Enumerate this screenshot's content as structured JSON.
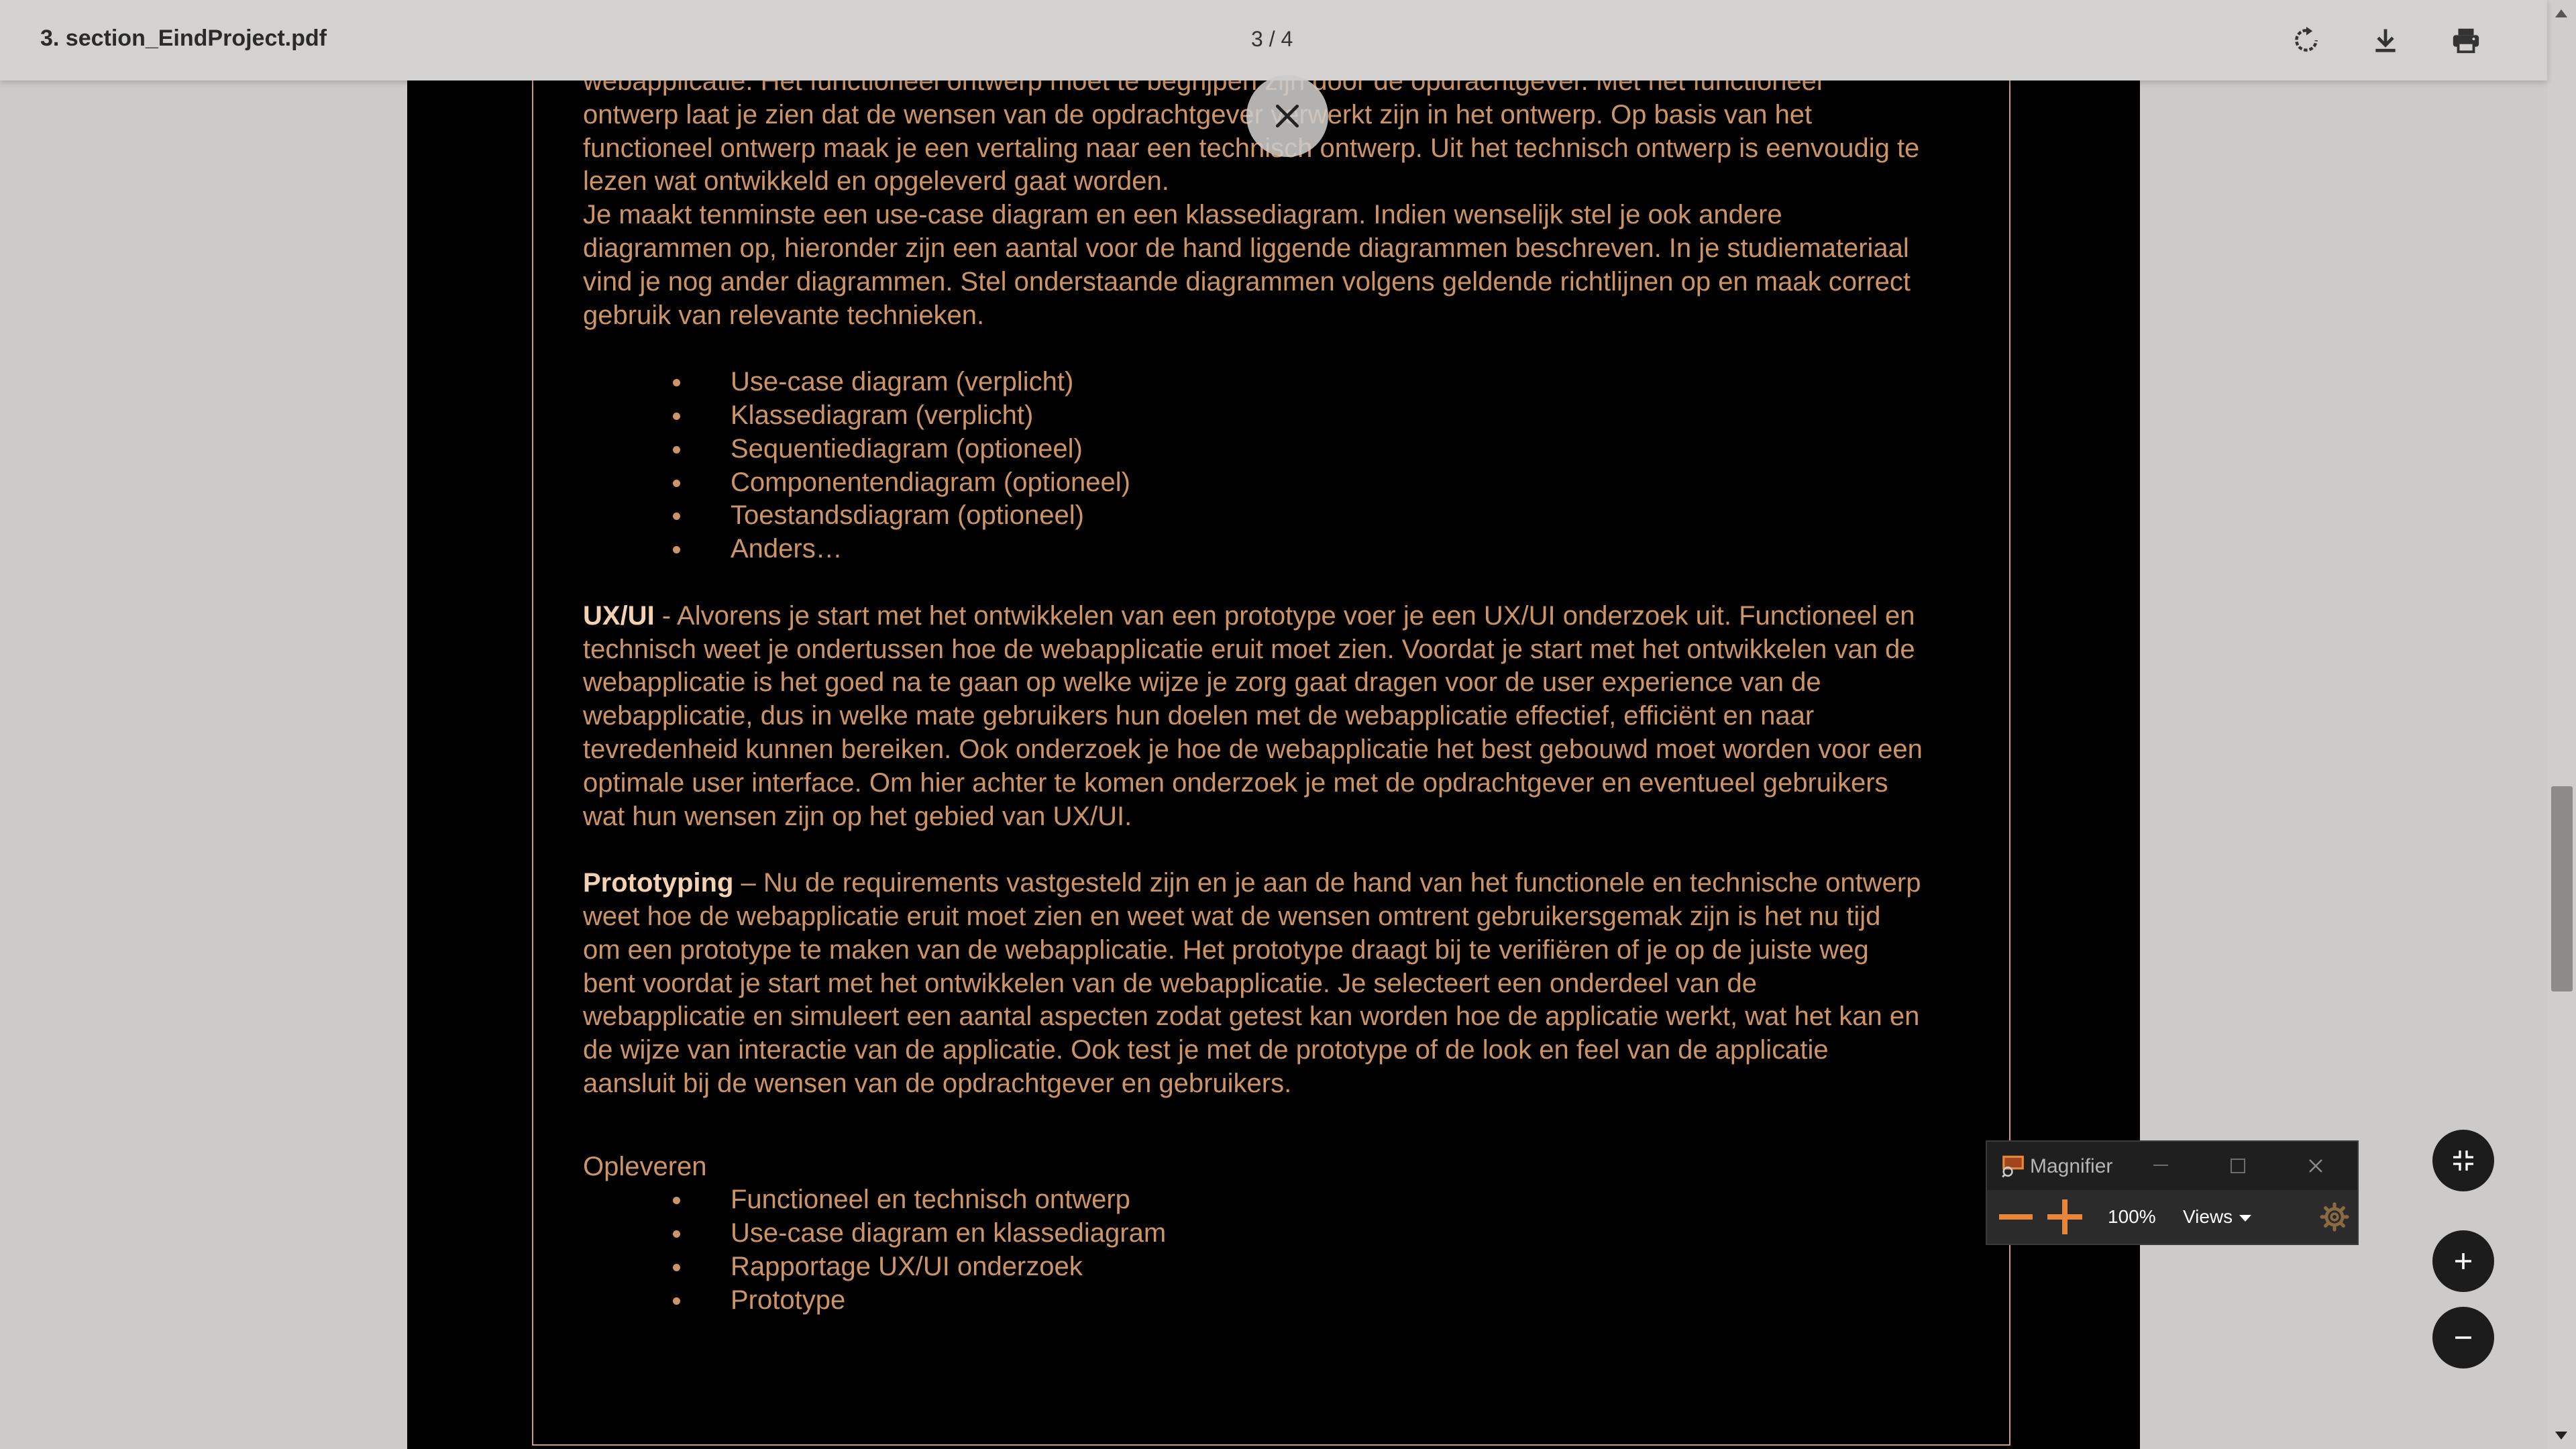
{
  "toolbar": {
    "filename": "3. section_EindProject.pdf",
    "page_indicator": "3 / 4"
  },
  "document": {
    "p_intro": "webapplicatie. Het functioneel ontwerp moet te begrijpen zijn door de opdrachtgever. Met het functioneel ontwerp laat je zien dat de wensen van de opdrachtgever verwerkt zijn in het ontwerp. Op basis van het functioneel ontwerp maak je een vertaling naar een technisch ontwerp. Uit het technisch ontwerp is eenvoudig te lezen wat ontwikkeld en opgeleverd gaat worden.",
    "p_diagrams": "Je maakt tenminste een use-case diagram en een klassediagram. Indien wenselijk stel je ook andere diagrammen op, hieronder zijn een aantal voor de hand liggende diagrammen beschreven. In je studiemateriaal vind je nog ander diagrammen. Stel onderstaande diagrammen volgens geldende richtlijnen op en maak correct gebruik van relevante technieken.",
    "diagram_list": [
      "Use-case diagram (verplicht)",
      "Klassediagram (verplicht)",
      "Sequentiediagram (optioneel)",
      "Componentendiagram (optioneel)",
      "Toestandsdiagram (optioneel)",
      "Anders…"
    ],
    "uxui_heading": "UX/UI",
    "uxui_text": " - Alvorens je start met het ontwikkelen van een prototype voer je een UX/UI onderzoek uit. Functioneel en technisch weet je ondertussen hoe de webapplicatie eruit moet zien. Voordat je start met het ontwikkelen van de webapplicatie is het goed na te gaan op welke wijze je zorg gaat dragen voor de user experience van de webapplicatie, dus in welke mate gebruikers hun doelen met de webapplicatie effectief, efficiënt en naar tevredenheid kunnen bereiken. Ook onderzoek je hoe de webapplicatie het best gebouwd moet worden voor een optimale user interface. Om hier achter te komen onderzoek je met de opdrachtgever en eventueel gebruikers wat hun wensen zijn op het gebied van UX/UI.",
    "proto_heading": "Prototyping",
    "proto_text": " – Nu de requirements vastgesteld zijn en je aan de hand van het functionele en technische ontwerp weet hoe de webapplicatie eruit moet zien en weet wat de wensen omtrent gebruikersgemak zijn is het nu tijd om een prototype te maken van de webapplicatie. Het prototype draagt bij te verifiëren of je op de juiste weg bent voordat je start met het ontwikkelen van de webapplicatie. Je selecteert een onderdeel van de webapplicatie en simuleert een aantal aspecten zodat getest kan worden hoe de applicatie werkt, wat het kan en de wijze van interactie van de applicatie. Ook test je met de prototype of de look en feel van de applicatie aansluit bij de wensen van de opdrachtgever en gebruikers.",
    "deliver_heading": "Opleveren",
    "deliver_list": [
      "Functioneel en technisch ontwerp",
      "Use-case diagram en klassediagram",
      "Rapportage UX/UI onderzoek",
      "Prototype"
    ]
  },
  "magnifier": {
    "title": "Magnifier",
    "zoom": "100%",
    "views_label": "Views",
    "accent": "#e8873a"
  },
  "colors": {
    "page_text": "#cd9468",
    "heading_text": "#f4d1b2",
    "page_background": "#000000"
  }
}
